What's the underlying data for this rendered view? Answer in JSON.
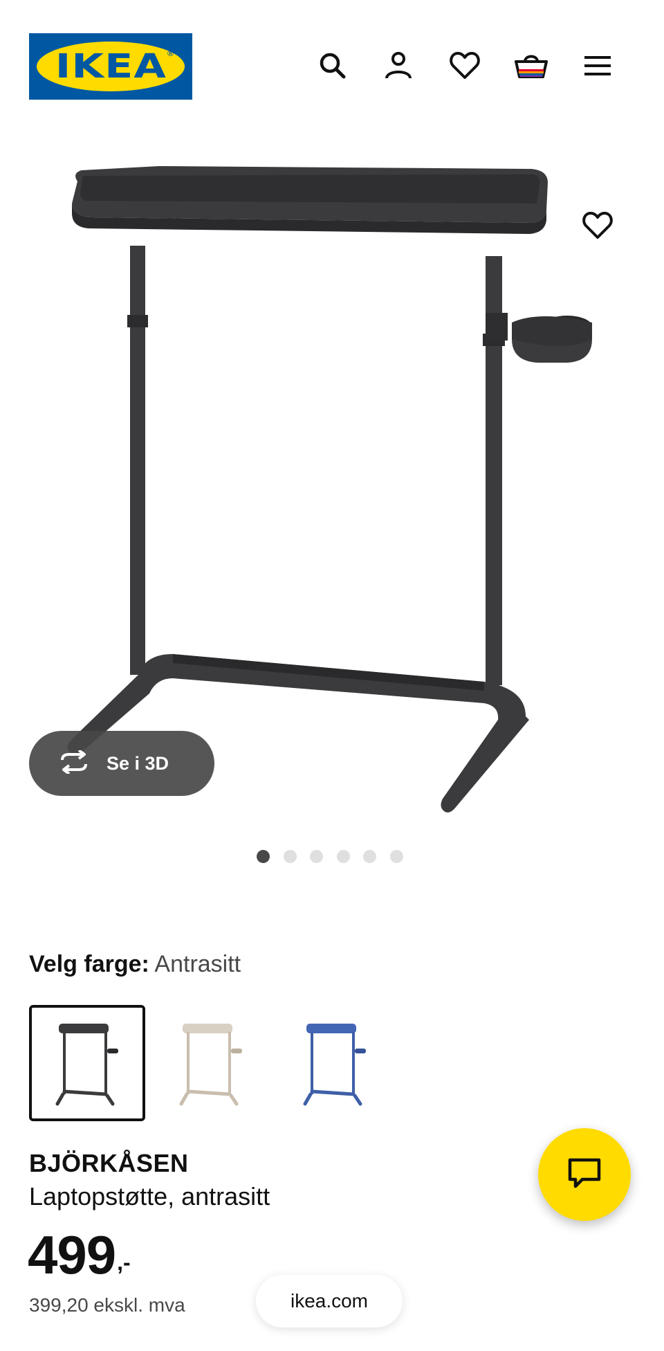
{
  "header": {
    "logo_text": "IKEA",
    "logo_reg": "®",
    "icons": [
      "search-icon",
      "account-icon",
      "favourites-heart-icon",
      "shopping-bag-icon",
      "hamburger-menu-icon"
    ]
  },
  "gallery": {
    "view_3d_label": "Se i 3D",
    "dot_count": 6,
    "active_dot": 1
  },
  "color_picker": {
    "label": "Velg farge:",
    "value": "Antrasitt",
    "options": [
      {
        "name": "antrasitt",
        "color": "#3b3b3d",
        "selected": true
      },
      {
        "name": "beige",
        "color": "#cfc6b8",
        "selected": false
      },
      {
        "name": "blue",
        "color": "#3f5fa8",
        "selected": false
      }
    ]
  },
  "product": {
    "name": "BJÖRKÅSEN",
    "description": "Laptopstøtte, antrasitt",
    "price": "499",
    "price_suffix": ",-",
    "price_ex_vat": "399,20 ekskl. mva"
  },
  "browser": {
    "url": "ikea.com"
  },
  "colors": {
    "ikea_blue": "#0058A3",
    "ikea_yellow": "#FFDB00",
    "product_dark": "#3b3b3d"
  }
}
